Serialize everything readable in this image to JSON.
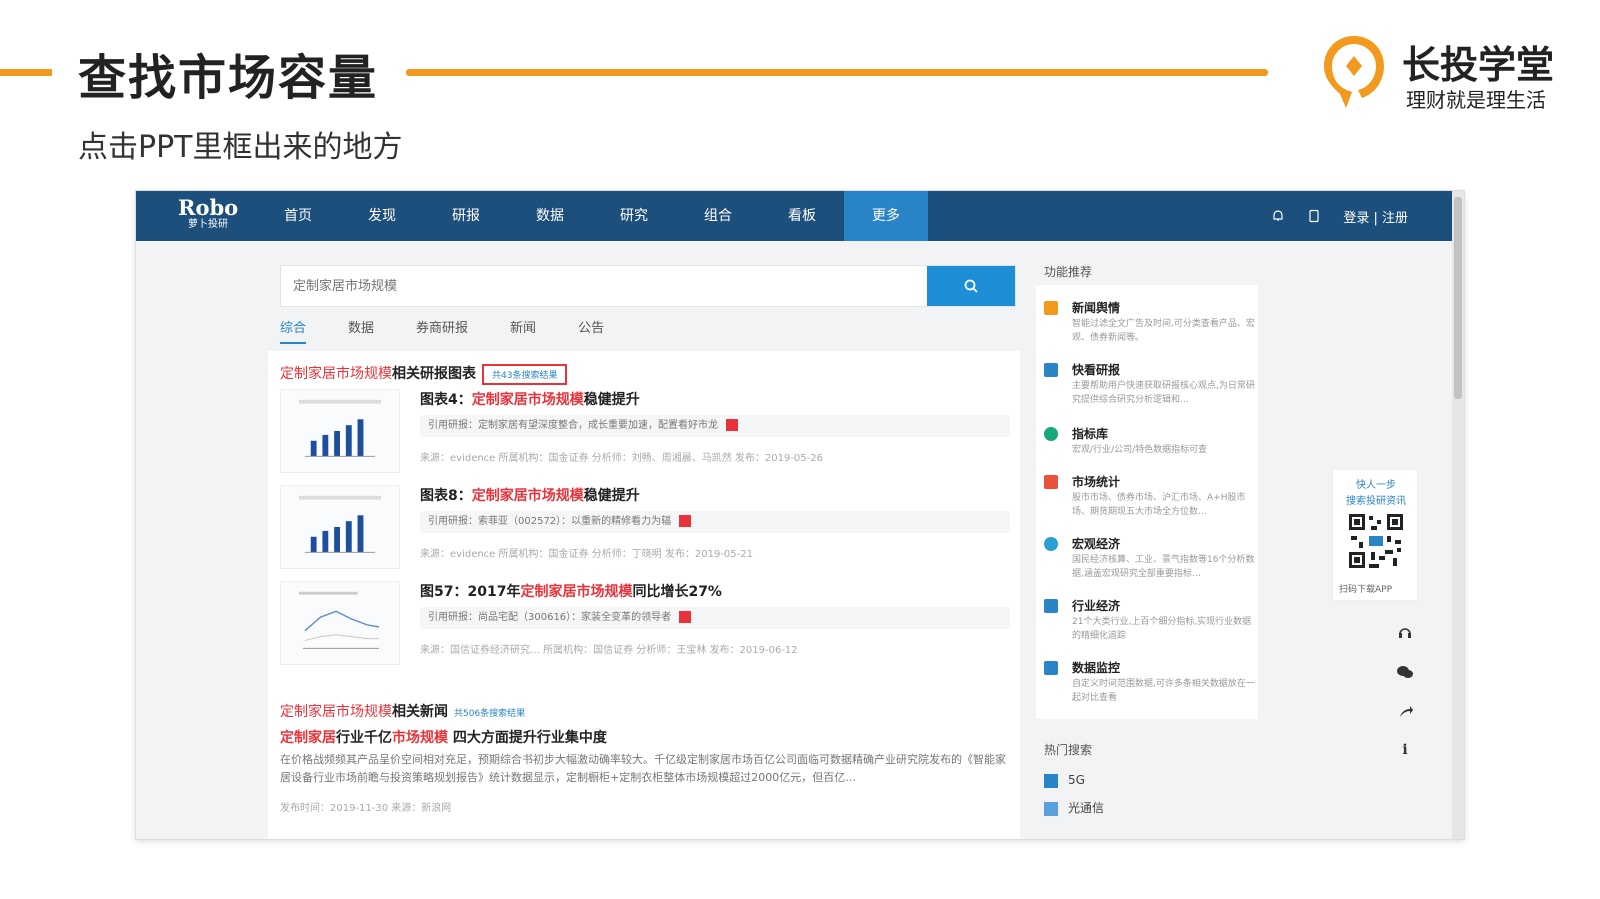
{
  "slide": {
    "title": "查找市场容量",
    "subtitle": "点击PPT里框出来的地方",
    "brand_name": "长投学堂",
    "brand_slogan": "理财就是理生活",
    "accent": "#f39a1e"
  },
  "nav": {
    "logo": "Robo",
    "logo_sub": "萝卜投研",
    "items": [
      "首页",
      "发现",
      "研报",
      "数据",
      "研究",
      "组合",
      "看板",
      "更多"
    ],
    "active_index": 7,
    "login": "登录 | 注册",
    "icons": [
      "bell-icon",
      "tablet-icon"
    ],
    "bg": "#1d4f7c",
    "active_bg": "#2a84c8"
  },
  "search": {
    "placeholder": "定制家居市场规模",
    "tabs": [
      "综合",
      "数据",
      "券商研报",
      "新闻",
      "公告"
    ],
    "active_tab": 0
  },
  "reports_section": {
    "keyword": "定制家居市场规模",
    "suffix": "相关研报图表",
    "tag": "共43条搜索结果",
    "items": [
      {
        "title_prefix": "图表4：",
        "title_hl": "定制家居市场规模",
        "title_suffix": "稳健提升",
        "cite": "引用研报：定制家居有望深度整合，成长重要加速，配置看好市龙",
        "meta": "来源：evidence    所属机构：国金证券    分析师：刘畅、周湘晨、马凯然    发布：2019-05-26"
      },
      {
        "title_prefix": "图表8：",
        "title_hl": "定制家居市场规模",
        "title_suffix": "稳健提升",
        "cite": "引用研报：索菲亚（002572）：以重新的精修看力为辐",
        "meta": "来源：evidence    所属机构：国金证券    分析师：丁晓明    发布：2019-05-21"
      },
      {
        "title_prefix": "图57：2017年",
        "title_hl": "定制家居市场规模",
        "title_suffix": "同比增长27%",
        "cite": "引用研报：尚品宅配（300616）：家装全变革的领导者",
        "meta": "来源：国信证券经济研究…    所属机构：国信证券    分析师：王宝林    发布：2019-06-12"
      }
    ]
  },
  "news_section": {
    "keyword": "定制家居市场规模",
    "suffix": "相关新闻",
    "tag": "共506条搜索结果",
    "title_hl1": "定制家居",
    "title_mid": "行业千亿",
    "title_hl2": "市场规模",
    "title_suffix": " 四大方面提升行业集中度",
    "body": "在价格战频频其产品呈价空间相对充足，预期综合书初步大幅激动确率较大。千亿级定制家居市场百亿公司面临可数据精确产业研究院发布的《智能家居设备行业市场前瞻与投资策略规划报告》统计数据显示，定制橱柜+定制衣柜整体市场规模超过2000亿元，但百亿…",
    "meta": "发布时间：2019-11-30    来源：新浪网"
  },
  "sidebar": {
    "features_label": "功能推荐",
    "features": [
      {
        "title": "新闻舆情",
        "desc": "智能过滤全文广告及时间,可分类查看产品、宏观、债券新闻等。",
        "icon": "news-icon",
        "color": "#f39a1e"
      },
      {
        "title": "快看研报",
        "desc": "主要帮助用户快速获取研报核心观点,为日常研究提供综合研究分析逻辑和…",
        "icon": "report-icon",
        "color": "#2a84c8"
      },
      {
        "title": "指标库",
        "desc": "宏观/行业/公司/特色数据指标可查",
        "icon": "chart-pie-icon",
        "color": "#1aa67c"
      },
      {
        "title": "市场统计",
        "desc": "股市市场、债券市场、沪汇市场、A+H股市场、期货期现五大市场全方位数…",
        "icon": "stats-icon",
        "color": "#e9513a"
      },
      {
        "title": "宏观经济",
        "desc": "国民经济核算、工业、景气指数等16个分析数据,涵盖宏观研究全部重要指标…",
        "icon": "globe-icon",
        "color": "#2a9fd6"
      },
      {
        "title": "行业经济",
        "desc": "21个大类行业,上百个细分指标,实现行业数据的精细化追踪",
        "icon": "industry-icon",
        "color": "#2a84c8"
      },
      {
        "title": "数据监控",
        "desc": "自定义时间范围数据,可许多条相关数据放在一起对比查看",
        "icon": "monitor-icon",
        "color": "#2a84c8"
      }
    ],
    "hot_label": "热门搜索",
    "hot": [
      "5G",
      "光通信"
    ]
  },
  "qr": {
    "line1": "快人一步",
    "line2": "搜索投研资讯",
    "download": "扫码下载APP"
  }
}
